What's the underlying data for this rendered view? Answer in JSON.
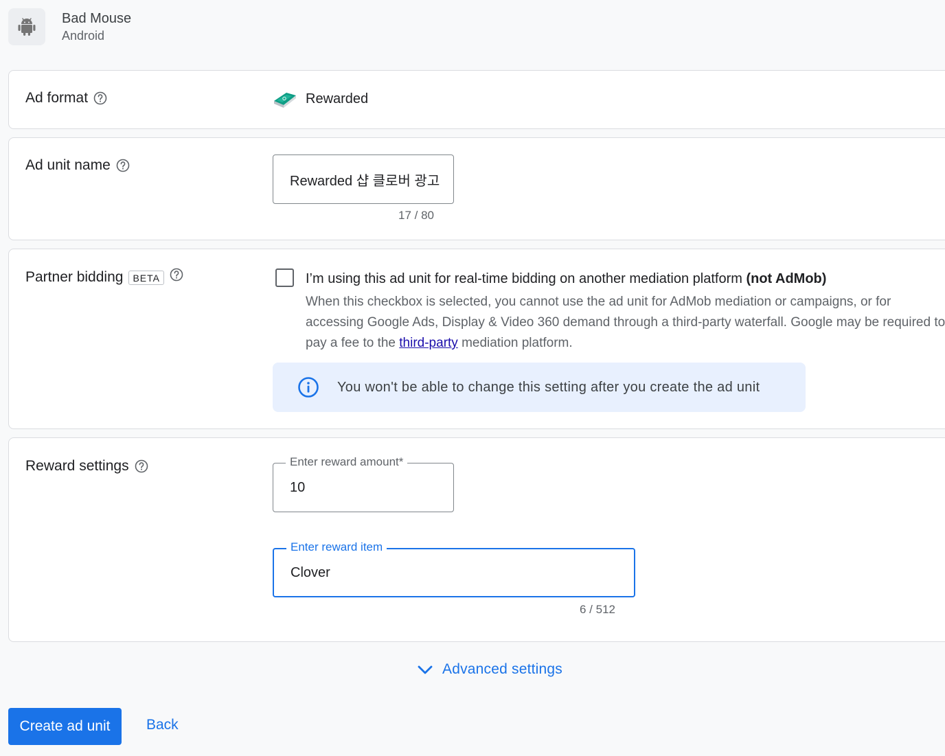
{
  "app": {
    "name": "Bad Mouse",
    "platform": "Android",
    "icon": "android-icon"
  },
  "ad_format": {
    "label": "Ad format",
    "value": "Rewarded",
    "icon": "rewarded-format-icon"
  },
  "ad_unit_name": {
    "label": "Ad unit name",
    "value": "Rewarded 샵 클로버 광고",
    "counter": "17 / 80"
  },
  "partner_bidding": {
    "label": "Partner bidding",
    "badge": "BETA",
    "checked": false,
    "checkbox_label": "I’m using this ad unit for real-time bidding on another mediation platform",
    "checkbox_label_bold": "(not AdMob)",
    "description_before_link": "When this checkbox is selected, you cannot use the ad unit for AdMob mediation or campaigns, or for accessing Google Ads, Display & Video 360 demand through a third-party waterfall. Google may be required to pay a fee to the ",
    "description_link": "third-party",
    "description_after_link": " mediation platform.",
    "info_message": "You won't be able to change this setting after you create the ad unit"
  },
  "reward_settings": {
    "label": "Reward settings",
    "amount_label": "Enter reward amount*",
    "amount_value": "10",
    "item_label": "Enter reward item",
    "item_value": "Clover",
    "item_counter": "6 / 512"
  },
  "advanced_settings": {
    "label": "Advanced settings"
  },
  "actions": {
    "create_label": "Create ad unit",
    "back_label": "Back"
  },
  "colors": {
    "primary": "#1a73e8",
    "info_background": "#e8f0fe",
    "page_background": "#f8f9fa"
  }
}
